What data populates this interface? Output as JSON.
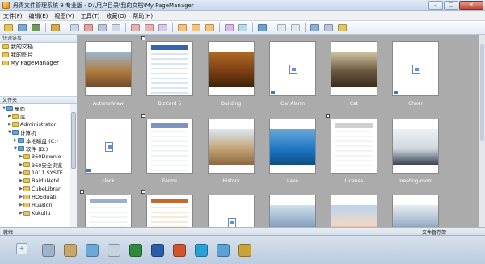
{
  "window": {
    "title": "丹青文件管理系统 9 专业版 - D:\\用户目录\\我的文档\\My PageManager"
  },
  "window_buttons": [
    "–",
    "□",
    "✕"
  ],
  "menu": [
    "文件(F)",
    "编辑(E)",
    "视图(V)",
    "工具(T)",
    "收藏(O)",
    "帮助(H)"
  ],
  "toolbar": {
    "groups": [
      [
        {
          "icon": "folder-open-icon",
          "color": "#e8c35a"
        },
        {
          "icon": "scan-icon",
          "color": "#7fa7d6"
        },
        {
          "icon": "camera-import-icon",
          "color": "#6c9a5b"
        }
      ],
      [
        {
          "icon": "folder-up-icon",
          "color": "#d9a94a"
        }
      ],
      [
        {
          "icon": "new-doc-icon",
          "color": "#c9d7ea"
        },
        {
          "icon": "edit-doc-icon",
          "color": "#e8a29c"
        },
        {
          "icon": "copy-doc-icon",
          "color": "#b8c8de"
        },
        {
          "icon": "paste-doc-icon",
          "color": "#cfd9e6"
        }
      ],
      [
        {
          "icon": "rotate-left-icon",
          "color": "#e7b2b2"
        },
        {
          "icon": "rotate-right-icon",
          "color": "#e7b2b2"
        },
        {
          "icon": "flip-icon",
          "color": "#d9c7e8"
        }
      ],
      [
        {
          "icon": "view-large-icon",
          "color": "#f2c47e"
        },
        {
          "icon": "view-list-icon",
          "color": "#f2c47e"
        },
        {
          "icon": "view-details-icon",
          "color": "#f2c47e"
        }
      ],
      [
        {
          "icon": "slideshow-icon",
          "color": "#d9b9e8"
        },
        {
          "icon": "compare-icon",
          "color": "#b9d8e8"
        }
      ],
      [
        {
          "icon": "screen-icon",
          "color": "#6c9ed9"
        }
      ],
      [
        {
          "icon": "zoom-out-icon",
          "color": "#dfe7f0"
        },
        {
          "icon": "zoom-in-icon",
          "color": "#dfe7f0"
        }
      ],
      [
        {
          "icon": "sync-icon",
          "color": "#8ab0da"
        },
        {
          "icon": "print-preview-icon",
          "color": "#b7c6d8"
        },
        {
          "icon": "settings-icon",
          "color": "#dcc56a"
        }
      ]
    ]
  },
  "quick_access": {
    "header": "快速链接",
    "items": [
      "我的文档",
      "我的图片",
      "My PageManager"
    ]
  },
  "folder_tree": {
    "header": "文件夹",
    "items": [
      {
        "label": "桌面",
        "depth": 0,
        "expander": "▼",
        "icon": "desktop"
      },
      {
        "label": "库",
        "depth": 1,
        "expander": "▶",
        "icon": "folder"
      },
      {
        "label": "Administrator",
        "depth": 1,
        "expander": "▶",
        "icon": "folder"
      },
      {
        "label": "计算机",
        "depth": 1,
        "expander": "▼",
        "icon": "computer"
      },
      {
        "label": "本地磁盘 (C:)",
        "depth": 2,
        "expander": "▶",
        "icon": "drive"
      },
      {
        "label": "软件 (D:)",
        "depth": 2,
        "expander": "▼",
        "icon": "drive"
      },
      {
        "label": "360Downlo",
        "depth": 3,
        "expander": "▶",
        "icon": "folder"
      },
      {
        "label": "360安全浏览",
        "depth": 3,
        "expander": "▶",
        "icon": "folder"
      },
      {
        "label": "1011 SYSTE",
        "depth": 3,
        "expander": "▶",
        "icon": "folder"
      },
      {
        "label": "BaiduNetd",
        "depth": 3,
        "expander": "▶",
        "icon": "folder"
      },
      {
        "label": "CubeLibrar",
        "depth": 3,
        "expander": "▶",
        "icon": "folder"
      },
      {
        "label": "HQEduati",
        "depth": 3,
        "expander": "▶",
        "icon": "folder"
      },
      {
        "label": "HuaBon",
        "depth": 3,
        "expander": "▶",
        "icon": "folder"
      },
      {
        "label": "Kukuliu",
        "depth": 3,
        "expander": "▶",
        "icon": "folder"
      }
    ]
  },
  "thumbnails": [
    {
      "label": "AutumnView",
      "kind": "photo",
      "colors": [
        "#9bb7d2",
        "#b07b3e",
        "#6d4b2b"
      ]
    },
    {
      "label": "BizCard 5",
      "kind": "doc",
      "colors": [
        "#ffffff",
        "#d7e6f7",
        "#2f65b3"
      ]
    },
    {
      "label": "Building",
      "kind": "photo",
      "colors": [
        "#b16a24",
        "#7d3f12",
        "#3d2107"
      ]
    },
    {
      "label": "Car Alarm",
      "kind": "file",
      "colors": [
        "#ffffff",
        "#ffffff",
        "#ffffff"
      ]
    },
    {
      "label": "Cat",
      "kind": "photo",
      "colors": [
        "#d1c7a2",
        "#6b5740",
        "#3b2a1a"
      ]
    },
    {
      "label": "Cheer",
      "kind": "file",
      "colors": [
        "#ffffff",
        "#ffffff",
        "#ffffff"
      ]
    },
    {
      "label": "clock",
      "kind": "file",
      "colors": [
        "#ffffff",
        "#ffffff",
        "#ffffff"
      ]
    },
    {
      "label": "Forms",
      "kind": "doc",
      "colors": [
        "#ffffff",
        "#f0f4fa",
        "#7a95c0"
      ]
    },
    {
      "label": "History",
      "kind": "photo",
      "colors": [
        "#d9e9f5",
        "#c4a274",
        "#8c6a40"
      ]
    },
    {
      "label": "Lake",
      "kind": "photo",
      "colors": [
        "#6aa7d8",
        "#1f78c4",
        "#0e4e84"
      ]
    },
    {
      "label": "License",
      "kind": "doc",
      "colors": [
        "#ffffff",
        "#f4f4f4",
        "#cfcfcf"
      ]
    },
    {
      "label": "meeting-room",
      "kind": "photo",
      "colors": [
        "#eef1f4",
        "#cfd7de",
        "#3a4450"
      ]
    },
    {
      "label": "",
      "kind": "doc",
      "colors": [
        "#ffffff",
        "#f1f3f7",
        "#9aaecd"
      ]
    },
    {
      "label": "",
      "kind": "doc",
      "colors": [
        "#ffffff",
        "#f7e9d7",
        "#c46a2b"
      ]
    },
    {
      "label": "",
      "kind": "file",
      "colors": [
        "#ffffff",
        "#ffffff",
        "#ffffff"
      ]
    },
    {
      "label": "",
      "kind": "photo",
      "colors": [
        "#cfe0ec",
        "#8da7c3",
        "#3e4a5c"
      ]
    },
    {
      "label": "",
      "kind": "photo",
      "colors": [
        "#b8d4ef",
        "#f0d8c8",
        "#b73b2a"
      ]
    },
    {
      "label": "",
      "kind": "photo",
      "colors": [
        "#e4edf5",
        "#9db3c8",
        "#3d4e66"
      ]
    }
  ],
  "status": {
    "left": "就绪",
    "right": "文件暂存架"
  },
  "taskbar": {
    "add_label": "+",
    "items": [
      {
        "icon": "printer-icon",
        "color": "#9fb3c8"
      },
      {
        "icon": "ruler-icon",
        "color": "#c8a86a"
      },
      {
        "icon": "image-viewer-icon",
        "color": "#69a9d6"
      },
      {
        "icon": "fax-icon",
        "color": "#c7d2de"
      },
      {
        "icon": "excel-icon",
        "color": "#2f8a3e"
      },
      {
        "icon": "word-icon",
        "color": "#2c5da8"
      },
      {
        "icon": "powerpoint-icon",
        "color": "#d0552c"
      },
      {
        "icon": "browser-icon",
        "color": "#2aa0d8"
      },
      {
        "icon": "photo-editor-icon",
        "color": "#5aa1d4"
      },
      {
        "icon": "archive-icon",
        "color": "#c8a33a"
      }
    ]
  }
}
